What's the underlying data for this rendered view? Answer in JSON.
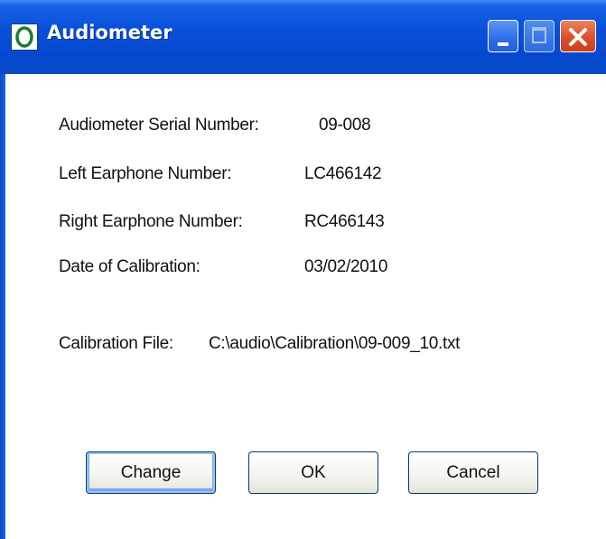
{
  "window": {
    "title": "Audiometer",
    "icon": "app-icon"
  },
  "fields": [
    {
      "label": "Audiometer Serial Number:",
      "value": "09-008"
    },
    {
      "label": "Left Earphone Number:",
      "value": "LC466142"
    },
    {
      "label": "Right Earphone Number:",
      "value": "RC466143"
    },
    {
      "label": "Date of Calibration:",
      "value": "03/02/2010"
    }
  ],
  "calibration_file": {
    "label": "Calibration File:",
    "value": "C:\\audio\\Calibration\\09-009_10.txt"
  },
  "buttons": {
    "change": "Change",
    "ok": "OK",
    "cancel": "Cancel"
  },
  "colors": {
    "titlebar": "#0950d8",
    "close_button": "#d9502a",
    "button_border": "#003c74"
  }
}
